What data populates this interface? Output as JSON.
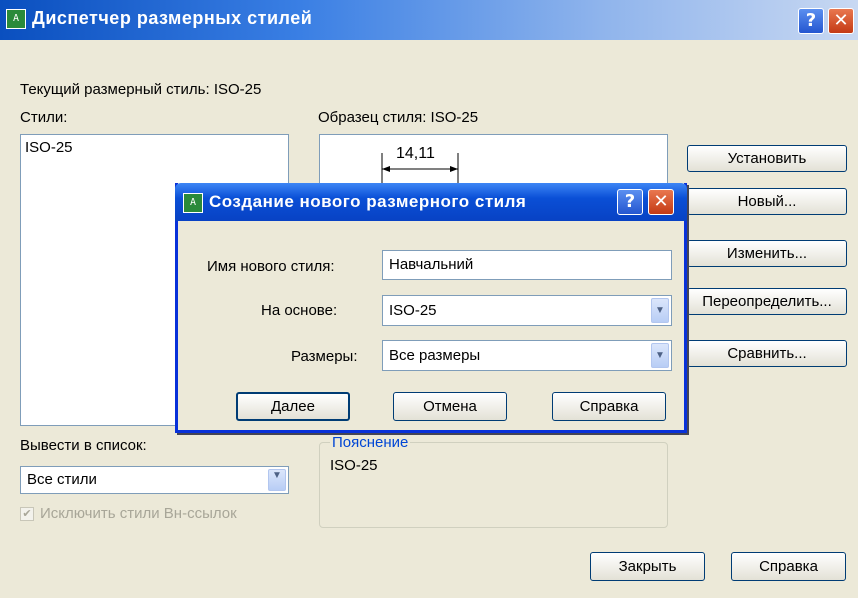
{
  "main_window": {
    "title": "Диспетчер размерных стилей",
    "current_style": "Текущий размерный стиль: ISO-25",
    "styles_label": "Стили:",
    "styles_list": [
      "ISO-25"
    ],
    "preview_label": "Образец стиля: ISO-25",
    "preview_dimension": "14,11",
    "list_label": "Вывести в список:",
    "list_filter": "Все стили",
    "exclude_xref_label": "Исключить стили Вн-ссылок",
    "description_label": "Пояснение",
    "description_text": "ISO-25",
    "buttons": {
      "set_current": "Установить",
      "new": "Новый...",
      "modify": "Изменить...",
      "override": "Переопределить...",
      "compare": "Сравнить...",
      "close": "Закрыть",
      "help": "Справка"
    }
  },
  "dialog": {
    "title": "Создание нового размерного стиля",
    "new_style_label": "Имя нового стиля:",
    "new_style_value": "Навчальний",
    "start_with_label": "На основе:",
    "start_with_value": "ISO-25",
    "use_for_label": "Размеры:",
    "use_for_value": "Все размеры",
    "buttons": {
      "continue": "Далее",
      "cancel": "Отмена",
      "help": "Справка"
    }
  },
  "titlebar_buttons": {
    "help": "?",
    "close": "✕"
  },
  "colors": {
    "titlebar": "#0a4fbf",
    "dialog_border": "#0831d9",
    "close_button": "#c43a15"
  }
}
